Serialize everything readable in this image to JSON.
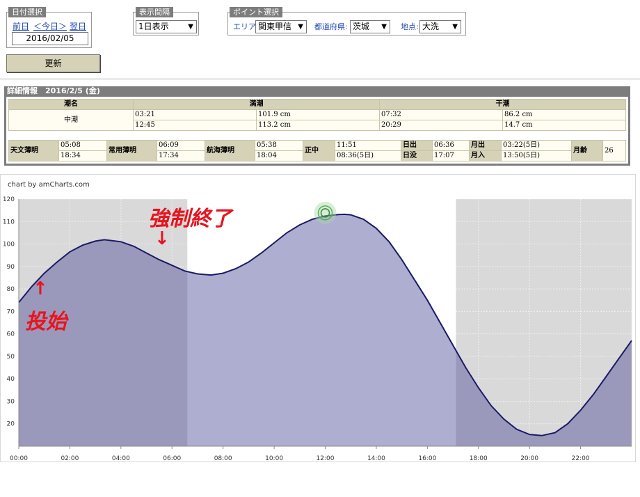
{
  "date_panel": {
    "tag": "日付選択",
    "prev": "前日",
    "today": "＜今日＞",
    "next": "翌日",
    "date": "2016/02/05"
  },
  "interval_panel": {
    "tag": "表示間隔",
    "value": "1日表示"
  },
  "point_panel": {
    "tag": "ポイント選択",
    "area_label": "エリア:",
    "area_value": "関東甲信",
    "pref_label": "都道府県:",
    "pref_value": "茨城",
    "place_label": "地点:",
    "place_value": "大洗"
  },
  "update_button": "更新",
  "detail": {
    "title": "詳細情報　2016/2/5 (金)",
    "tide_headers": [
      "潮名",
      "満潮",
      "干潮"
    ],
    "tide_name": "中潮",
    "high": [
      {
        "time": "03:21",
        "height": "101.9 cm"
      },
      {
        "time": "12:45",
        "height": "113.2 cm"
      }
    ],
    "low": [
      {
        "time": "07:32",
        "height": "86.2 cm"
      },
      {
        "time": "20:29",
        "height": "14.7 cm"
      }
    ],
    "labels": {
      "astro": "天文薄明",
      "civil": "常用薄明",
      "nautical": "航海薄明",
      "noon": "正中",
      "sunrise": "日出",
      "sunset": "日没",
      "moonrise": "月出",
      "moonset": "月入",
      "moonage": "月齢"
    },
    "astro": [
      "05:08",
      "18:34"
    ],
    "civil": [
      "06:09",
      "17:34"
    ],
    "nautical": [
      "05:38",
      "18:04"
    ],
    "noon": [
      "11:51",
      "08:36(5日)"
    ],
    "sunrise": "06:36",
    "sunset": "17:07",
    "moonrise": "03:22(5日)",
    "moonset": "13:50(5日)",
    "moonage": "26"
  },
  "chart_credit": "chart by amCharts.com",
  "annotations": {
    "start": "投始",
    "end": "強制終了",
    "arrow_up": "↑",
    "arrow_down": "↓"
  },
  "colors": {
    "night_band": "#d9d9d9",
    "fill_night": "#9b99bb",
    "fill_day": "#aeaed1",
    "line": "#1a1a66",
    "annotation": "#e8141e",
    "panel_tag": "#7d7d7d",
    "header_bg": "#d6d2b8"
  },
  "chart_data": {
    "type": "area",
    "title": "",
    "xlabel": "",
    "ylabel": "",
    "xlim": [
      0,
      24
    ],
    "ylim": [
      10,
      120
    ],
    "x_ticks": [
      "00:00",
      "02:00",
      "04:00",
      "06:00",
      "08:00",
      "10:00",
      "12:00",
      "14:00",
      "16:00",
      "18:00",
      "20:00",
      "22:00"
    ],
    "y_ticks": [
      20,
      30,
      40,
      50,
      60,
      70,
      80,
      90,
      100,
      110,
      120
    ],
    "night_ranges": [
      [
        0,
        6.6
      ],
      [
        17.12,
        24
      ]
    ],
    "highlight_point": [
      12.0,
      112
    ],
    "series": [
      {
        "x": [
          0,
          0.5,
          1,
          1.5,
          2,
          2.5,
          3,
          3.35,
          4,
          4.5,
          5,
          5.5,
          6,
          6.5,
          7,
          7.53,
          8,
          8.5,
          9,
          9.5,
          10,
          10.5,
          11,
          11.5,
          12,
          12.5,
          12.75,
          13,
          13.5,
          14,
          14.5,
          15,
          15.5,
          16,
          16.5,
          17,
          17.5,
          18,
          18.5,
          19,
          19.5,
          20,
          20.48,
          21,
          21.5,
          22,
          22.5,
          23,
          23.5,
          24
        ],
        "values": [
          74,
          81,
          87,
          92,
          96.5,
          99.5,
          101.3,
          101.9,
          101,
          99,
          96,
          93,
          90.5,
          88,
          86.7,
          86.2,
          87,
          89,
          92,
          96,
          100.5,
          105,
          108.5,
          111,
          112.5,
          113.1,
          113.2,
          113,
          111,
          107,
          101,
          93,
          84,
          75,
          65,
          55,
          45,
          36,
          28,
          22,
          17.5,
          15.2,
          14.7,
          16,
          20,
          26,
          33,
          41,
          49,
          57
        ]
      }
    ]
  }
}
